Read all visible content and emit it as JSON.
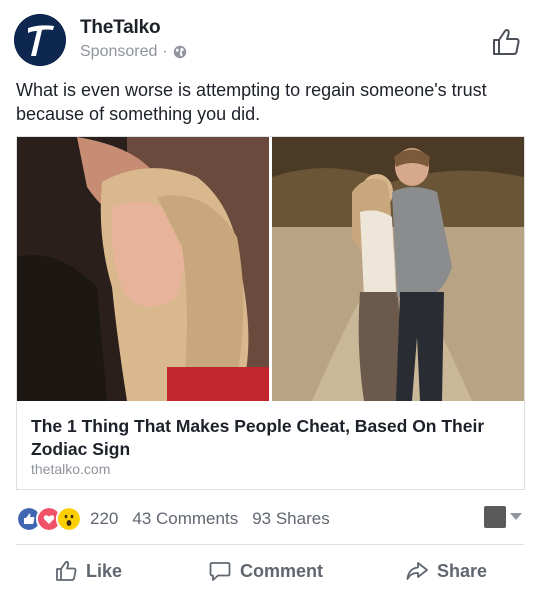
{
  "post": {
    "page_name": "TheTalko",
    "sponsored_label": "Sponsored",
    "separator": "·",
    "caption": "What is even worse is attempting to regain someone's trust because of something you did.",
    "link": {
      "title": "The 1 Thing That Makes People Cheat, Based On Their Zodiac Sign",
      "domain": "thetalko.com"
    }
  },
  "engagement": {
    "reaction_count": "220",
    "comments": "43 Comments",
    "shares": "93 Shares",
    "reaction_icons": [
      "like-reaction-icon",
      "love-reaction-icon",
      "wow-reaction-icon"
    ]
  },
  "actions": {
    "like": "Like",
    "comment": "Comment",
    "share": "Share"
  },
  "colors": {
    "brand_blue": "#4267b2",
    "love_red": "#f25268",
    "wow_yellow": "#fcd000",
    "muted_text": "#606770"
  }
}
